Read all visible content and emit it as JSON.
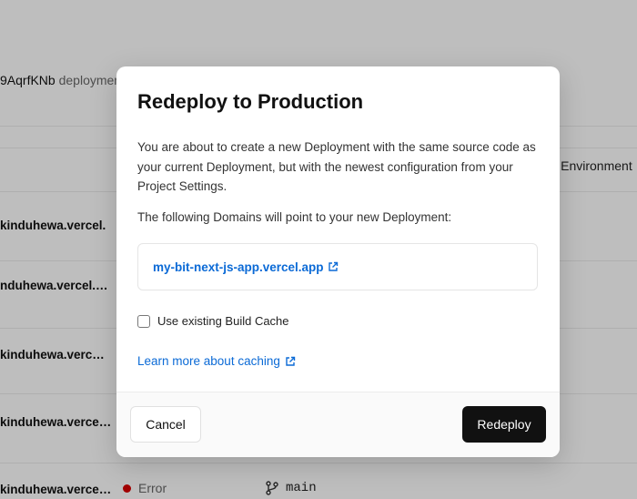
{
  "background": {
    "deployment_id": "9AqrfKNb",
    "deployment_suffix": "deploymen",
    "environment": "ll Environment",
    "rows": [
      "kinduhewa.vercel.",
      "nduhewa.vercel.…",
      "kinduhewa.verc…",
      "kinduhewa.verce…",
      "kinduhewa.verce…"
    ],
    "status": "Error",
    "branch": "main"
  },
  "modal": {
    "title": "Redeploy to Production",
    "description": "You are about to create a new Deployment with the same source code as your current Deployment, but with the newest configuration from your Project Settings.",
    "domains_label": "The following Domains will point to your new Deployment:",
    "domain": "my-bit-next-js-app.vercel.app",
    "cache_label": "Use existing Build Cache",
    "cache_checked": false,
    "learn_more": "Learn more about caching",
    "cancel_label": "Cancel",
    "redeploy_label": "Redeploy"
  },
  "colors": {
    "link": "#0b6ad6",
    "primary_button": "#111111",
    "error": "#d40000"
  }
}
